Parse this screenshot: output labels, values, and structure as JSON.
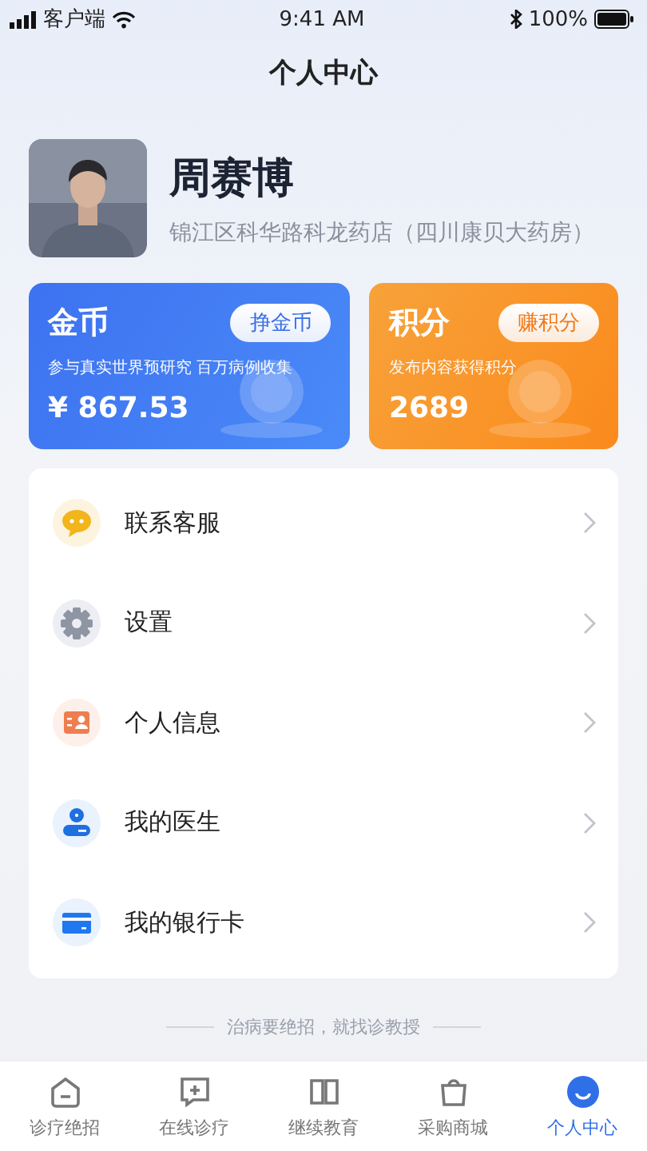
{
  "status_bar": {
    "carrier": "客户端",
    "time": "9:41 AM",
    "battery": "100%"
  },
  "title": "个人中心",
  "profile": {
    "name": "周赛博",
    "store": "锦江区科华路科龙药店（四川康贝大药房）"
  },
  "wallets": [
    {
      "kind": "coins",
      "title": "金币",
      "action": "挣金币",
      "subtitle": "参与真实世界预研究 百万病例收集",
      "amount": "¥ 867.53"
    },
    {
      "kind": "points",
      "title": "积分",
      "action": "赚积分",
      "subtitle": "发布内容获得积分",
      "amount": "2689"
    }
  ],
  "menu": [
    {
      "kind": "chat",
      "label": "联系客服"
    },
    {
      "kind": "gear",
      "label": "设置"
    },
    {
      "kind": "profile",
      "label": "个人信息"
    },
    {
      "kind": "doctor",
      "label": "我的医生"
    },
    {
      "kind": "card",
      "label": "我的银行卡"
    }
  ],
  "slogan": "治病要绝招，就找诊教授",
  "tabs": [
    {
      "kind": "home",
      "label": "诊疗绝招",
      "selected": false
    },
    {
      "kind": "chat",
      "label": "在线诊疗",
      "selected": false
    },
    {
      "kind": "edu",
      "label": "继续教育",
      "selected": false
    },
    {
      "kind": "shop",
      "label": "采购商城",
      "selected": false
    },
    {
      "kind": "me",
      "label": "个人中心",
      "selected": true
    }
  ]
}
